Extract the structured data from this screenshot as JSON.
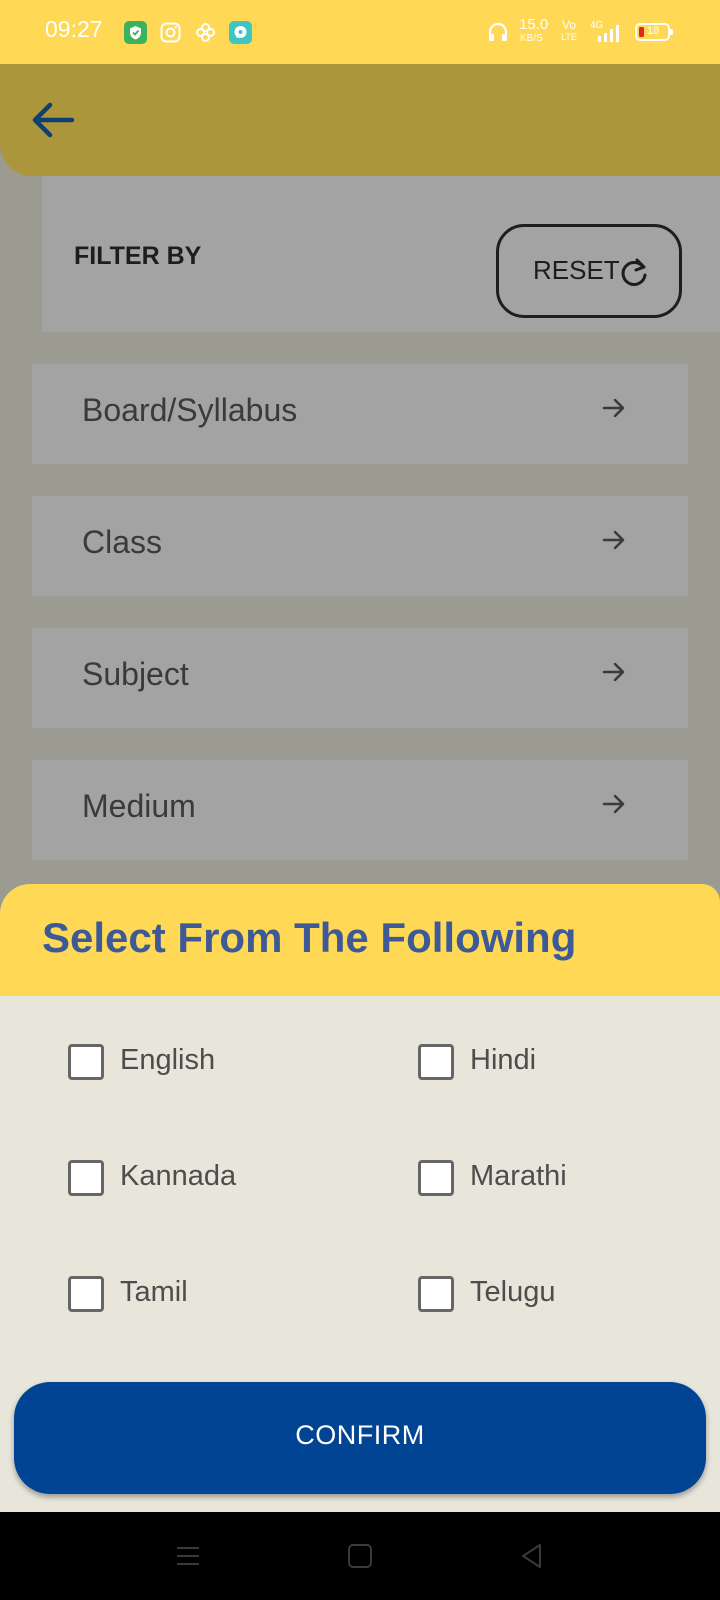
{
  "status_bar": {
    "time": "09:27",
    "notification_icons": [
      "shield-icon",
      "instagram-icon",
      "pinwheel-icon",
      "chat-icon"
    ],
    "net_speed_value": "15.0",
    "net_speed_unit": "KB/S",
    "volte_top": "Vo",
    "volte_bottom": "LTE",
    "network_type": "4G",
    "battery_level": "18",
    "colors": {
      "bar": "#ffd856",
      "text": "#ffffff"
    }
  },
  "header": {
    "back_icon": "arrow-left-icon"
  },
  "filter": {
    "title": "FILTER BY",
    "reset_label": "RESET",
    "reset_icon": "refresh-icon",
    "items": [
      {
        "label": "Board/Syllabus",
        "icon": "arrow-right-icon"
      },
      {
        "label": "Class",
        "icon": "arrow-right-icon"
      },
      {
        "label": "Subject",
        "icon": "arrow-right-icon"
      },
      {
        "label": "Medium",
        "icon": "arrow-right-icon"
      }
    ]
  },
  "sheet": {
    "title": "Select From The Following",
    "options": [
      {
        "label": "English",
        "checked": false
      },
      {
        "label": "Hindi",
        "checked": false
      },
      {
        "label": "Kannada",
        "checked": false
      },
      {
        "label": "Marathi",
        "checked": false
      },
      {
        "label": "Tamil",
        "checked": false
      },
      {
        "label": "Telugu",
        "checked": false
      }
    ],
    "confirm_label": "CONFIRM"
  },
  "nav_bar": {
    "icons": [
      "menu-icon",
      "home-square-icon",
      "back-triangle-icon"
    ]
  },
  "colors": {
    "accent_yellow": "#ffd856",
    "title_blue": "#3d5a96",
    "confirm_blue": "#004493",
    "sheet_bg": "#e8e6da"
  }
}
